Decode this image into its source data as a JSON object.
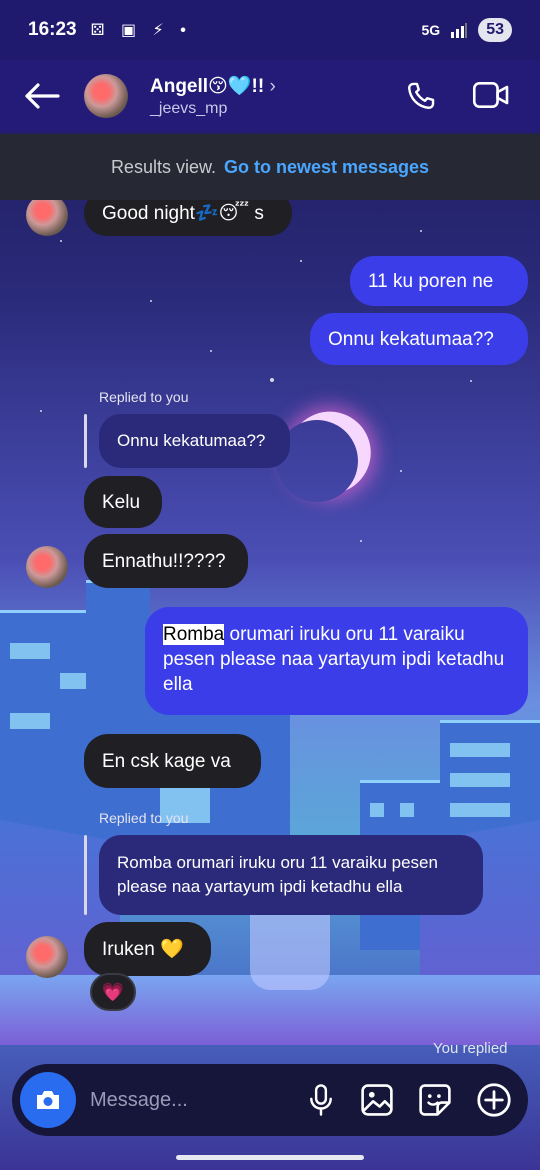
{
  "status": {
    "time": "16:23",
    "left_icons": "⚄ ▣ ⚡ •",
    "network": "5G",
    "battery": "53"
  },
  "header": {
    "name": "Angell😚🩵!!",
    "handle": "_jeevs_mp",
    "chevron": "›"
  },
  "results_banner": {
    "text": "Results view.",
    "link": "Go to newest messages"
  },
  "messages": [
    {
      "text": "Good night💤😴 s"
    },
    {
      "text": "11 ku poren ne"
    },
    {
      "text": "Onnu kekatumaa??"
    },
    {
      "text": "Kelu"
    },
    {
      "text": "Ennathu!!????"
    },
    {
      "highlight": "Romba",
      "text": " orumari iruku oru 11 varaiku pesen please naa yartayum ipdi ketadhu ella"
    },
    {
      "text": "En csk kage va"
    },
    {
      "text": "Iruken 💛"
    }
  ],
  "replies": [
    {
      "label": "Replied to you",
      "quote": "Onnu kekatumaa??"
    },
    {
      "label": "Replied to you",
      "quote": "Romba orumari iruku oru 11 varaiku pesen please naa yartayum ipdi ketadhu ella"
    }
  ],
  "reaction": "💗",
  "you_replied": "You replied",
  "composer": {
    "placeholder": "Message..."
  },
  "colors": {
    "outgoing": "#3a3de8",
    "incoming": "#1f1f24",
    "link": "#4aa6ff",
    "header": "#241a78"
  }
}
